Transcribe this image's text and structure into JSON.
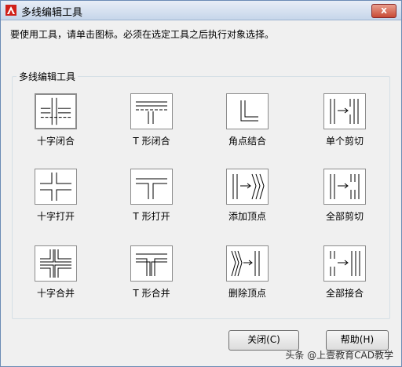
{
  "window": {
    "title": "多线编辑工具",
    "close_glyph": "x"
  },
  "instruction": "要使用工具，请单击图标。必须在选定工具之后执行对象选择。",
  "group": {
    "label": "多线编辑工具"
  },
  "tools": [
    {
      "label": "十字闭合",
      "icon": "closed-cross-icon"
    },
    {
      "label": "T 形闭合",
      "icon": "closed-tee-icon"
    },
    {
      "label": "角点结合",
      "icon": "corner-joint-icon"
    },
    {
      "label": "单个剪切",
      "icon": "cut-single-icon"
    },
    {
      "label": "十字打开",
      "icon": "open-cross-icon"
    },
    {
      "label": "T 形打开",
      "icon": "open-tee-icon"
    },
    {
      "label": "添加顶点",
      "icon": "add-vertex-icon"
    },
    {
      "label": "全部剪切",
      "icon": "cut-all-icon"
    },
    {
      "label": "十字合并",
      "icon": "merged-cross-icon"
    },
    {
      "label": "T 形合并",
      "icon": "merged-tee-icon"
    },
    {
      "label": "删除顶点",
      "icon": "delete-vertex-icon"
    },
    {
      "label": "全部接合",
      "icon": "weld-all-icon"
    }
  ],
  "buttons": {
    "close": "关闭(C)",
    "help": "帮助(H)"
  },
  "watermark": "头条 @上壹教育CAD教学",
  "colors": {
    "app_icon_red": "#d0201a",
    "close_button": "#c84a36"
  }
}
